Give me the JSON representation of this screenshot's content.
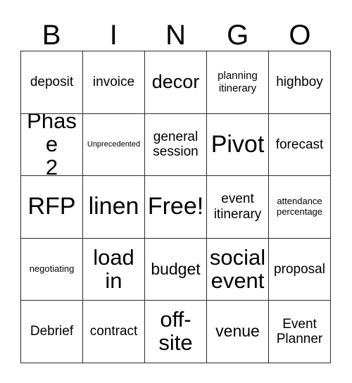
{
  "card": {
    "type": "bingo-card",
    "header_letters": [
      "B",
      "I",
      "N",
      "G",
      "O"
    ],
    "grid_size": "5x5",
    "free_space": "Free!",
    "colors": {
      "background": "#ffffff",
      "text": "#000000",
      "border": "#2b2b2b"
    },
    "rows": [
      [
        {
          "text": "deposit",
          "size": "md"
        },
        {
          "text": "invoice",
          "size": "md"
        },
        {
          "text": "decor",
          "size": "xl"
        },
        {
          "text": "planning\nitinerary",
          "size": "smd"
        },
        {
          "text": "highboy",
          "size": "md"
        }
      ],
      [
        {
          "text": "Phase\n2",
          "size": "xxl"
        },
        {
          "text": "Unprecedented",
          "size": "xs"
        },
        {
          "text": "general\nsession",
          "size": "md"
        },
        {
          "text": "Pivot",
          "size": "3xl"
        },
        {
          "text": "forecast",
          "size": "md"
        }
      ],
      [
        {
          "text": "RFP",
          "size": "3xl"
        },
        {
          "text": "linen",
          "size": "3xl"
        },
        {
          "text": "Free!",
          "size": "3xl"
        },
        {
          "text": "event\nitinerary",
          "size": "md"
        },
        {
          "text": "attendance\npercentage",
          "size": "sm"
        }
      ],
      [
        {
          "text": "negotiating",
          "size": "sm"
        },
        {
          "text": "load\nin",
          "size": "xxl"
        },
        {
          "text": "budget",
          "size": "lg"
        },
        {
          "text": "social\nevent",
          "size": "xxl"
        },
        {
          "text": "proposal",
          "size": "md"
        }
      ],
      [
        {
          "text": "Debrief",
          "size": "md"
        },
        {
          "text": "contract",
          "size": "md"
        },
        {
          "text": "off-\nsite",
          "size": "xxl"
        },
        {
          "text": "venue",
          "size": "lg"
        },
        {
          "text": "Event\nPlanner",
          "size": "md"
        }
      ]
    ]
  }
}
